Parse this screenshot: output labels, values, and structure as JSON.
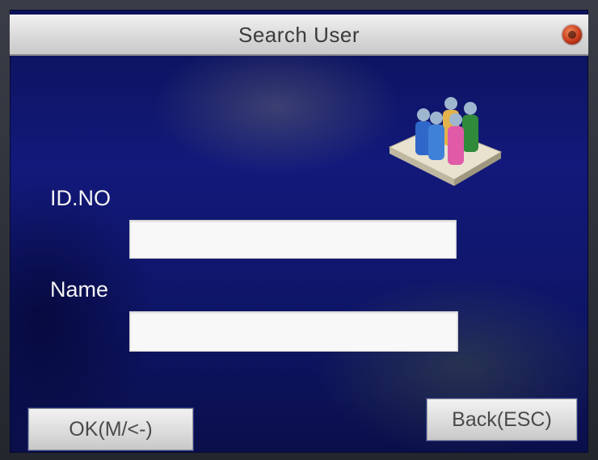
{
  "window": {
    "title": "Search User",
    "close_icon": "close-icon"
  },
  "illustration": {
    "icon": "user-group-icon"
  },
  "form": {
    "id_label": "ID.NO",
    "id_value": "",
    "name_label": "Name",
    "name_value": ""
  },
  "softkeys": {
    "ok_label": "OK(M/<-)",
    "back_label": "Back(ESC)"
  },
  "colors": {
    "screen_background": "#12197a",
    "title_bar": "#d9d9d9",
    "label_text": "#f4f4f4",
    "close_icon": "#c73a1c"
  }
}
